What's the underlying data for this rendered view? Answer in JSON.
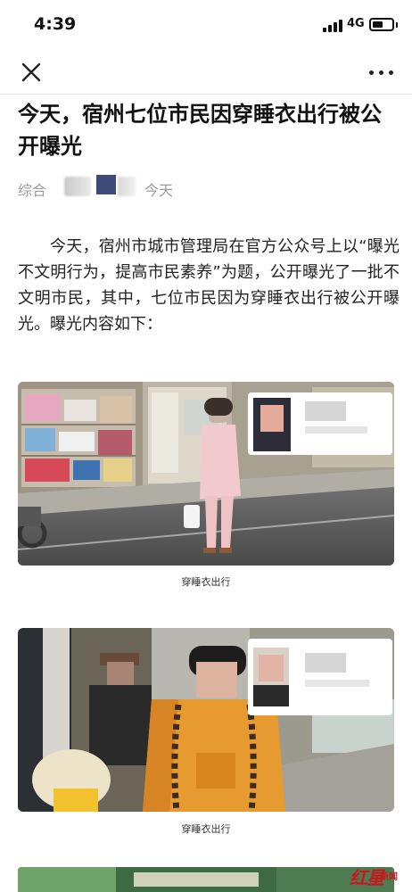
{
  "status_bar": {
    "time": "4:39",
    "network": "4G",
    "battery_level": 0.55
  },
  "nav": {
    "close_icon": "close-icon",
    "more_icon": "more-dots-icon"
  },
  "article": {
    "title": "今天，宿州七位市民因穿睡衣出行被公开曝光",
    "category": "综合",
    "date": "今天",
    "paragraph": "今天，宿州市城市管理局在官方公众号上以“曝光不文明行为，提高市民素养”为题，公开曝光了一批不文明市民，其中，七位市民因为穿睡衣出行被公开曝光。曝光内容如下："
  },
  "photos": [
    {
      "caption": "穿睡衣出行"
    },
    {
      "caption": "穿睡衣出行"
    }
  ],
  "watermark": {
    "logo": "红星",
    "sub": "新闻"
  },
  "colors": {
    "accent_red": "#c8181e",
    "meta_gray": "#9a9a9a"
  }
}
